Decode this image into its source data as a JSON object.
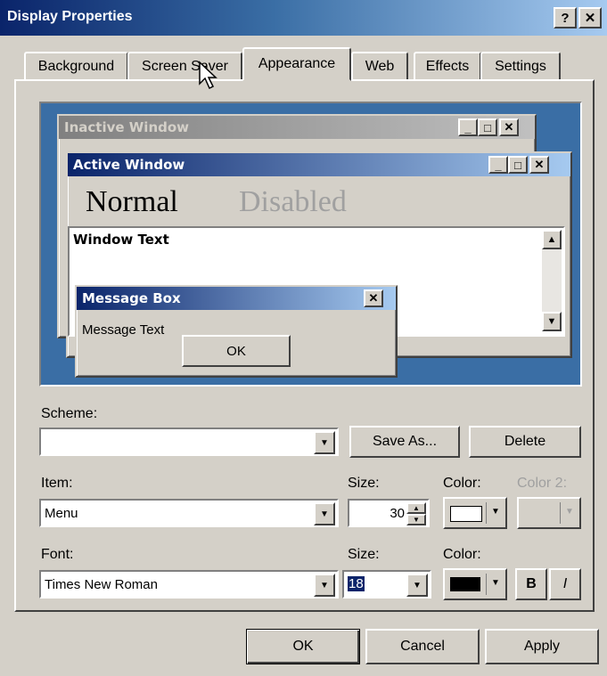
{
  "window": {
    "title": "Display Properties",
    "help_label": "?",
    "close_label": "✕"
  },
  "tabs": [
    {
      "label": "Background"
    },
    {
      "label": "Screen Saver"
    },
    {
      "label": "Appearance"
    },
    {
      "label": "Web"
    },
    {
      "label": "Effects"
    },
    {
      "label": "Settings"
    }
  ],
  "preview": {
    "inactive_title": "Inactive Window",
    "active_title": "Active Window",
    "normal_label": "Normal",
    "disabled_label": "Disabled",
    "window_text": "Window Text",
    "msgbox_title": "Message Box",
    "msgbox_text": "Message Text",
    "msgbox_ok": "OK"
  },
  "scheme": {
    "label": "Scheme:",
    "value": "",
    "save_as": "Save As...",
    "delete": "Delete"
  },
  "item": {
    "label": "Item:",
    "value": "Menu",
    "size_label": "Size:",
    "size_value": "30",
    "color_label": "Color:",
    "color2_label": "Color 2:"
  },
  "font": {
    "label": "Font:",
    "value": "Times New Roman",
    "size_label": "Size:",
    "size_value": "18",
    "color_label": "Color:",
    "bold": "B",
    "italic": "I"
  },
  "buttons": {
    "ok": "OK",
    "cancel": "Cancel",
    "apply": "Apply"
  },
  "colors": {
    "active_caption": "#0a246a",
    "inactive_caption": "#808080",
    "desktop": "#3a6ea5",
    "face": "#d4d0c8"
  }
}
